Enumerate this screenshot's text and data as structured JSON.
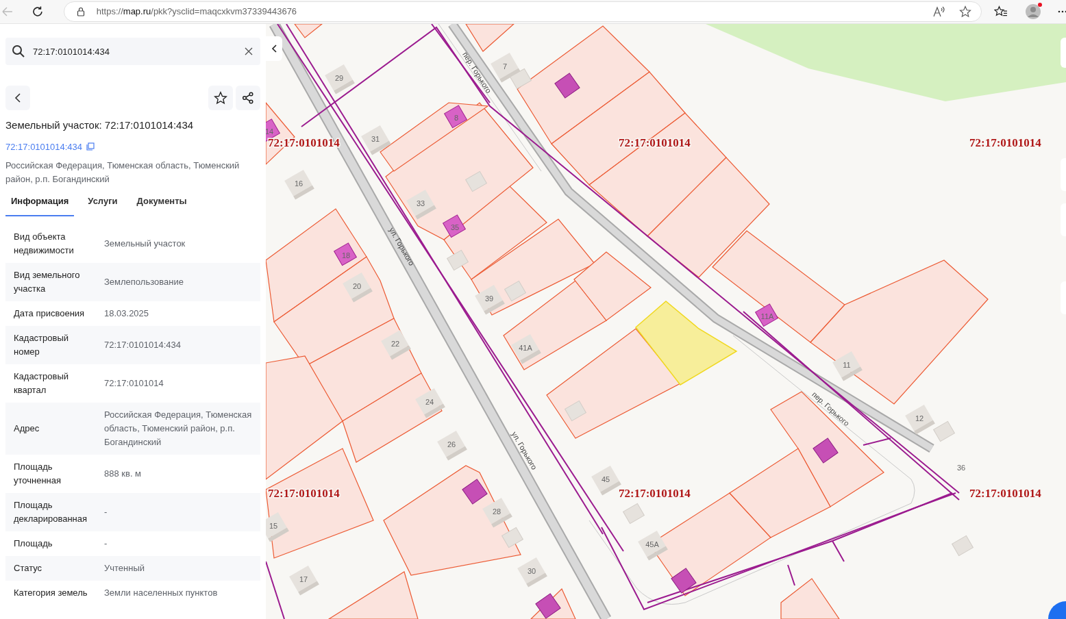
{
  "browser": {
    "url": "https://**map.ru**/pkk?ysclid=maqcxkvm37339443676"
  },
  "search": {
    "value": "72:17:0101014:434"
  },
  "panel": {
    "title": "Земельный участок: 72:17:0101014:434",
    "link": "72:17:0101014:434",
    "address": "Российская Федерация, Тюменская область, Тюменский район, р.п. Богандинский",
    "tabs": [
      {
        "label": "Информация",
        "selected": true
      },
      {
        "label": "Услуги",
        "selected": false
      },
      {
        "label": "Документы",
        "selected": false
      }
    ],
    "rows": [
      {
        "label": "Вид объекта недвижимости",
        "value": "Земельный участок"
      },
      {
        "label": "Вид земельного участка",
        "value": "Землепользование"
      },
      {
        "label": "Дата присвоения",
        "value": "18.03.2025"
      },
      {
        "label": "Кадастровый номер",
        "value": "72:17:0101014:434"
      },
      {
        "label": "Кадастровый квартал",
        "value": "72:17:0101014"
      },
      {
        "label": "Адрес",
        "value": "Российская Федерация, Тюменская область, Тюменский район, р.п. Богандинский"
      },
      {
        "label": "Площадь уточненная",
        "value": "888 кв. м"
      },
      {
        "label": "Площадь декларированная",
        "value": "-"
      },
      {
        "label": "Площадь",
        "value": "-"
      },
      {
        "label": "Статус",
        "value": "Учтенный"
      },
      {
        "label": "Категория земель",
        "value": "Земли населенных пунктов"
      }
    ]
  },
  "map": {
    "quarter_labels": [
      "72:17:0101014",
      "72:17:0101014",
      "72:17:0101014",
      "72:17:0101014",
      "72:17:0101014",
      "72:17:0101014"
    ],
    "street_labels": [
      "пер. Горького",
      "ул. Горького",
      "ул. Горького",
      "пер. Горького"
    ],
    "house_numbers": [
      "29",
      "7",
      "8",
      "31",
      "16",
      "33",
      "35",
      "18",
      "20",
      "39",
      "22",
      "41А",
      "24",
      "26",
      "45",
      "28",
      "30",
      "17",
      "15",
      "14",
      "11А",
      "11",
      "12",
      "36",
      "45А"
    ]
  }
}
